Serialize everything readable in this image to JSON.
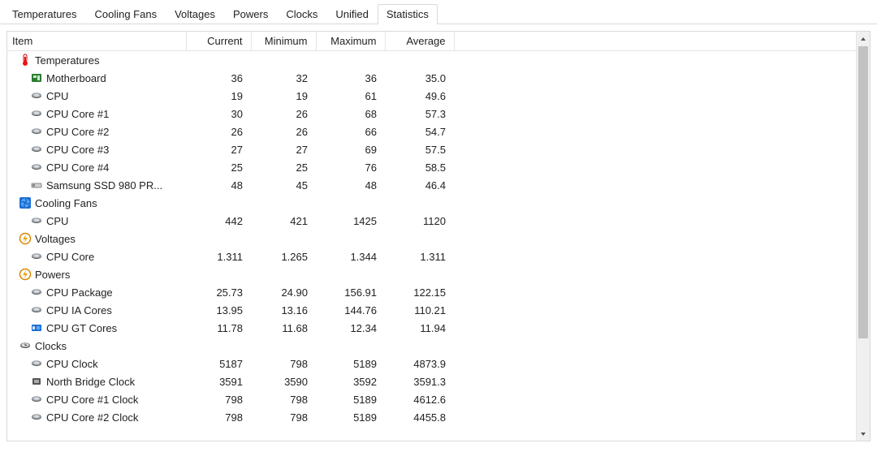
{
  "tabs": [
    {
      "label": "Temperatures",
      "active": false
    },
    {
      "label": "Cooling Fans",
      "active": false
    },
    {
      "label": "Voltages",
      "active": false
    },
    {
      "label": "Powers",
      "active": false
    },
    {
      "label": "Clocks",
      "active": false
    },
    {
      "label": "Unified",
      "active": false
    },
    {
      "label": "Statistics",
      "active": true
    }
  ],
  "columns": {
    "item": "Item",
    "current": "Current",
    "minimum": "Minimum",
    "maximum": "Maximum",
    "average": "Average"
  },
  "rows": [
    {
      "kind": "group",
      "icon": "thermometer",
      "label": "Temperatures"
    },
    {
      "kind": "data",
      "icon": "mobo",
      "label": "Motherboard",
      "current": "36",
      "minimum": "32",
      "maximum": "36",
      "average": "35.0"
    },
    {
      "kind": "data",
      "icon": "cpu",
      "label": "CPU",
      "current": "19",
      "minimum": "19",
      "maximum": "61",
      "average": "49.6"
    },
    {
      "kind": "data",
      "icon": "cpu",
      "label": "CPU Core #1",
      "current": "30",
      "minimum": "26",
      "maximum": "68",
      "average": "57.3"
    },
    {
      "kind": "data",
      "icon": "cpu",
      "label": "CPU Core #2",
      "current": "26",
      "minimum": "26",
      "maximum": "66",
      "average": "54.7"
    },
    {
      "kind": "data",
      "icon": "cpu",
      "label": "CPU Core #3",
      "current": "27",
      "minimum": "27",
      "maximum": "69",
      "average": "57.5"
    },
    {
      "kind": "data",
      "icon": "cpu",
      "label": "CPU Core #4",
      "current": "25",
      "minimum": "25",
      "maximum": "76",
      "average": "58.5"
    },
    {
      "kind": "data",
      "icon": "ssd",
      "label": "Samsung SSD 980 PR...",
      "current": "48",
      "minimum": "45",
      "maximum": "48",
      "average": "46.4"
    },
    {
      "kind": "group",
      "icon": "fan",
      "label": "Cooling Fans"
    },
    {
      "kind": "data",
      "icon": "cpu",
      "label": "CPU",
      "current": "442",
      "minimum": "421",
      "maximum": "1425",
      "average": "1120"
    },
    {
      "kind": "group",
      "icon": "power",
      "label": "Voltages"
    },
    {
      "kind": "data",
      "icon": "cpu",
      "label": "CPU Core",
      "current": "1.311",
      "minimum": "1.265",
      "maximum": "1.344",
      "average": "1.311"
    },
    {
      "kind": "group",
      "icon": "power",
      "label": "Powers"
    },
    {
      "kind": "data",
      "icon": "cpu",
      "label": "CPU Package",
      "current": "25.73",
      "minimum": "24.90",
      "maximum": "156.91",
      "average": "122.15"
    },
    {
      "kind": "data",
      "icon": "cpu",
      "label": "CPU IA Cores",
      "current": "13.95",
      "minimum": "13.16",
      "maximum": "144.76",
      "average": "110.21"
    },
    {
      "kind": "data",
      "icon": "gpu",
      "label": "CPU GT Cores",
      "current": "11.78",
      "minimum": "11.68",
      "maximum": "12.34",
      "average": "11.94"
    },
    {
      "kind": "group",
      "icon": "clock",
      "label": "Clocks"
    },
    {
      "kind": "data",
      "icon": "cpu",
      "label": "CPU Clock",
      "current": "5187",
      "minimum": "798",
      "maximum": "5189",
      "average": "4873.9"
    },
    {
      "kind": "data",
      "icon": "chip",
      "label": "North Bridge Clock",
      "current": "3591",
      "minimum": "3590",
      "maximum": "3592",
      "average": "3591.3"
    },
    {
      "kind": "data",
      "icon": "cpu",
      "label": "CPU Core #1 Clock",
      "current": "798",
      "minimum": "798",
      "maximum": "5189",
      "average": "4612.6"
    },
    {
      "kind": "data",
      "icon": "cpu",
      "label": "CPU Core #2 Clock",
      "current": "798",
      "minimum": "798",
      "maximum": "5189",
      "average": "4455.8"
    }
  ]
}
